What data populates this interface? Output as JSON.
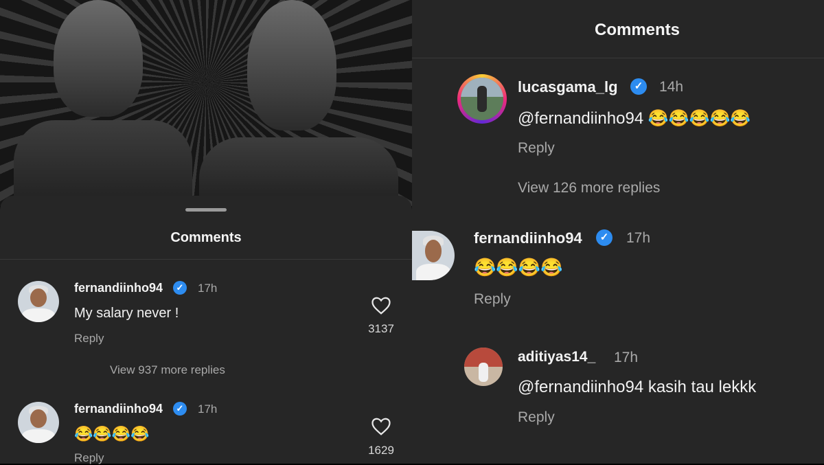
{
  "left": {
    "title": "Comments",
    "comments": [
      {
        "username": "fernandiinho94",
        "time": "17h",
        "text": "My salary never !",
        "reply": "Reply",
        "more_replies": "View 937 more replies",
        "likes": "3137"
      },
      {
        "username": "fernandiinho94",
        "time": "17h",
        "text": "😂😂😂😂",
        "reply": "Reply",
        "likes": "1629"
      }
    ]
  },
  "right": {
    "title": "Comments",
    "comments": [
      {
        "username": "lucasgama_lg",
        "time": "14h",
        "text": "@fernandiinho94 😂😂😂😂😂",
        "reply": "Reply",
        "more_replies": "View 126 more replies"
      },
      {
        "username": "fernandiinho94",
        "time": "17h",
        "text": "😂😂😂😂",
        "reply": "Reply"
      },
      {
        "username": "aditiyas14_",
        "time": "17h",
        "text": "@fernandiinho94 kasih tau lekkk",
        "reply": "Reply"
      }
    ]
  },
  "colors": {
    "panel": "#262626",
    "verified": "#2d8cf0",
    "muted": "#a9a9a9"
  }
}
